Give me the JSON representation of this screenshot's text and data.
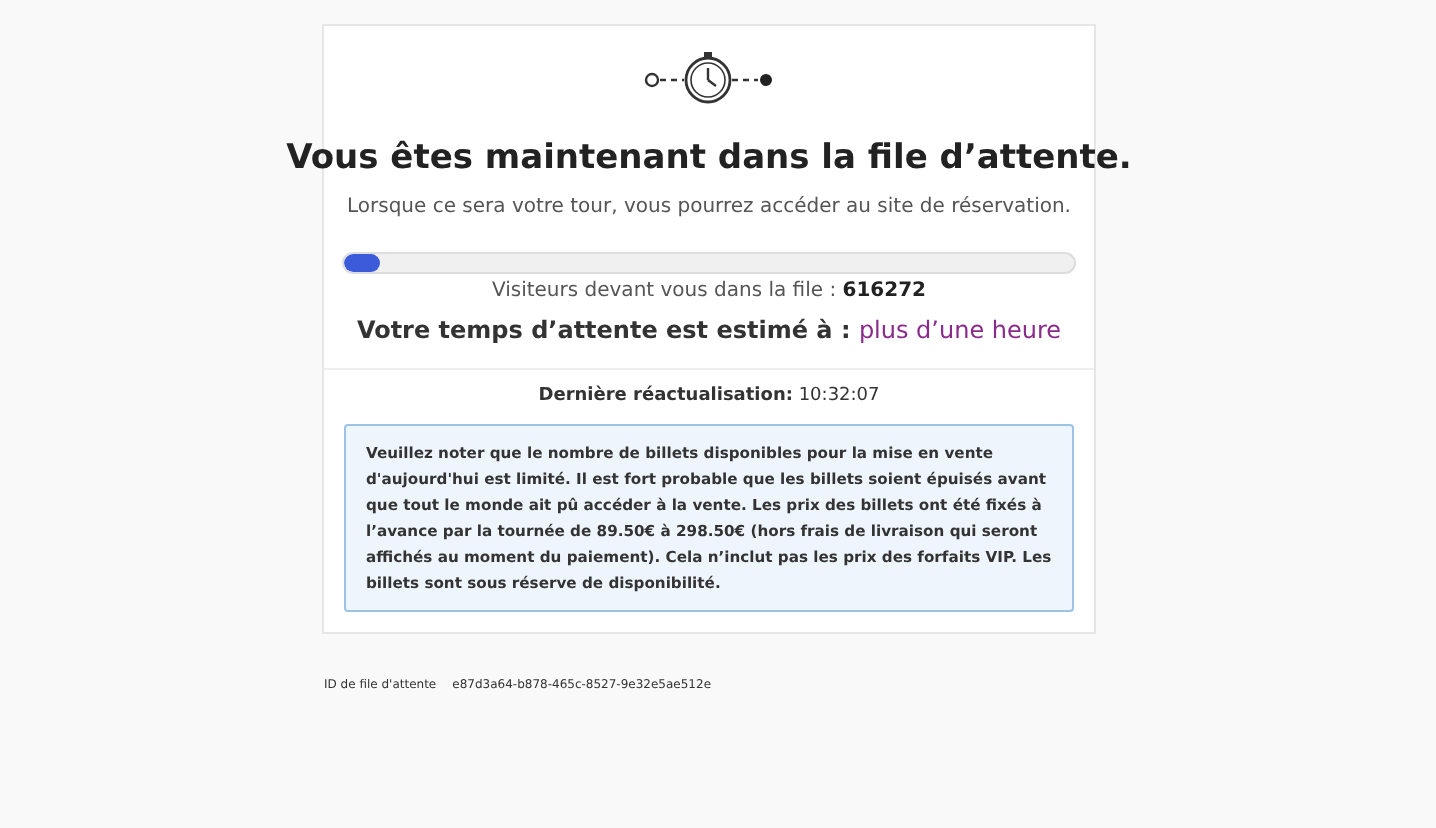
{
  "title": "Vous êtes maintenant dans la file d’attente.",
  "subtitle": "Lorsque ce sera votre tour, vous pourrez accéder au site de réservation.",
  "progress": {
    "level": 0.05
  },
  "visitors": {
    "label": "Visiteurs devant vous dans la file :",
    "value": "616272"
  },
  "wait": {
    "label": "Votre temps d’attente est estimé à :",
    "value": "plus d’une heure"
  },
  "last_update": {
    "label": "Dernière réactualisation:",
    "value": "10:32:07"
  },
  "notice": "Veuillez noter que le nombre de billets disponibles pour la mise en vente d'aujourd'hui est limité. Il est fort probable que les billets soient épuisés avant que tout le monde ait pû accéder à la vente. Les prix des billets ont été fixés à l’avance par la tournée de 89.50€ à 298.50€ (hors frais de livraison qui seront affichés au moment du paiement). Cela n’inclut pas les prix des forfaits VIP. Les billets sont sous réserve de disponibilité.",
  "queue_id": {
    "label": "ID de file d'attente",
    "value": "e87d3a64-b878-465c-8527-9e32e5ae512e"
  }
}
